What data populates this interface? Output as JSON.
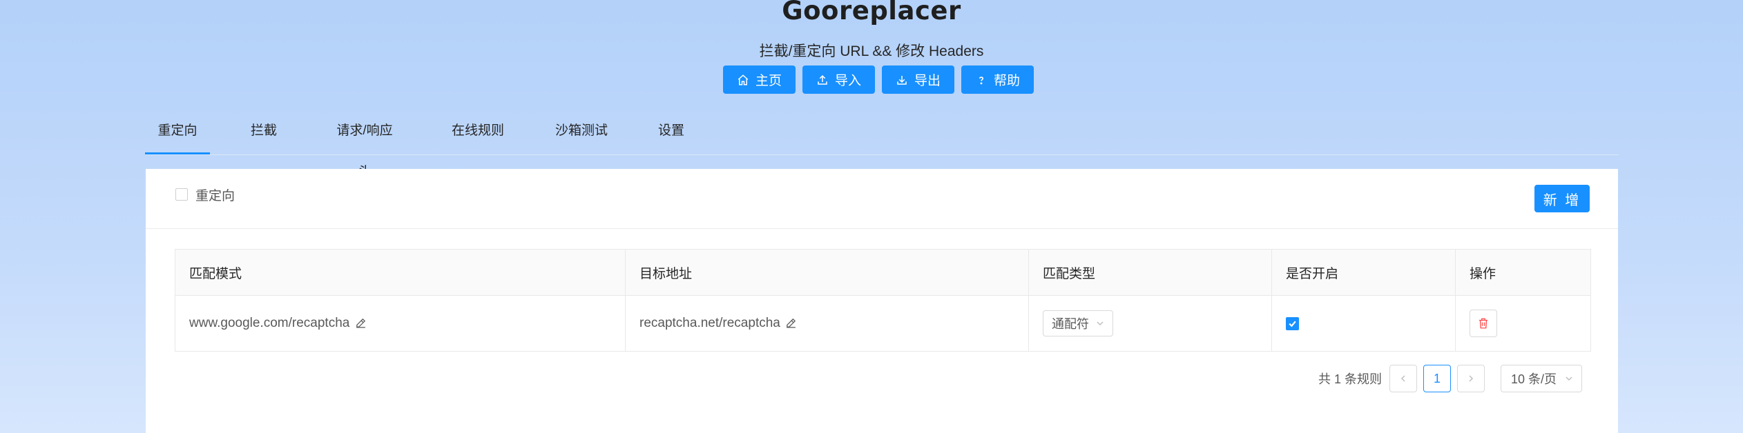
{
  "app": {
    "title": "Gooreplacer",
    "subtitle": "拦截/重定向 URL && 修改 Headers"
  },
  "toolbar": {
    "home": "主页",
    "import": "导入",
    "export": "导出",
    "help": "帮助"
  },
  "tabs": [
    "重定向",
    "拦截",
    "请求/响应头",
    "在线规则",
    "沙箱测试",
    "设置"
  ],
  "active_tab": "重定向",
  "card": {
    "filter_label": "重定向",
    "add_button": "新 增"
  },
  "table": {
    "headers": [
      "匹配模式",
      "目标地址",
      "匹配类型",
      "是否开启",
      "操作"
    ],
    "rows": [
      {
        "pattern": "www.google.com/recaptcha",
        "target": "recaptcha.net/recaptcha",
        "match_type": "通配符",
        "enabled": true
      }
    ]
  },
  "pagination": {
    "total_text": "共 1 条规则",
    "current_page": "1",
    "page_size": "10 条/页"
  },
  "colors": {
    "accent": "#1890ff",
    "delete": "#ff4d4f"
  },
  "icons": {
    "home": "home-icon",
    "import": "upload-icon",
    "export": "download-icon",
    "help": "question-icon",
    "edit": "edit-icon",
    "delete": "trash-icon"
  }
}
